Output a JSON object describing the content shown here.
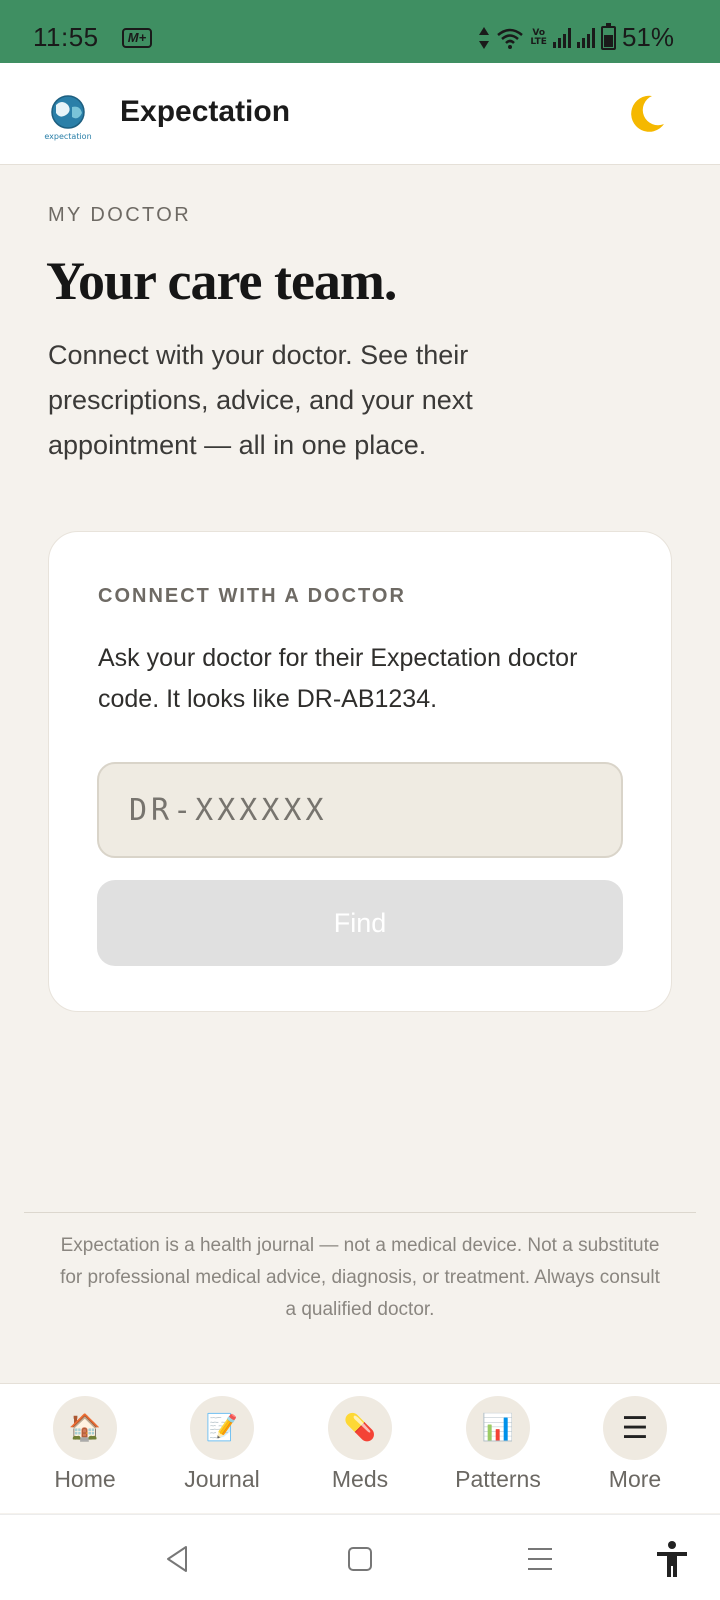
{
  "status_bar": {
    "time": "11:55",
    "app_badge": "M+",
    "network_label": "VoLTE",
    "battery_percent": "51%"
  },
  "header": {
    "app_title": "Expectation",
    "logo_text": "expectation",
    "theme_icon": "moon-icon"
  },
  "main": {
    "eyebrow": "MY DOCTOR",
    "title": "Your care team.",
    "description": "Connect with your doctor. See their prescriptions, advice, and your next appointment — all in one place."
  },
  "connect_card": {
    "label": "CONNECT WITH A DOCTOR",
    "text": "Ask your doctor for their Expectation doctor code. It looks like DR-AB1234.",
    "input_placeholder": "DR-XXXXXX",
    "input_value": "",
    "button_label": "Find"
  },
  "disclaimer": "Expectation is a health journal — not a medical device. Not a substitute for professional medical advice, diagnosis, or treatment. Always consult a qualified doctor.",
  "bottom_nav": {
    "items": [
      {
        "label": "Home",
        "icon": "🏠"
      },
      {
        "label": "Journal",
        "icon": "📝"
      },
      {
        "label": "Meds",
        "icon": "💊"
      },
      {
        "label": "Patterns",
        "icon": "📊"
      },
      {
        "label": "More",
        "icon": "☰"
      }
    ]
  },
  "colors": {
    "status_bar": "#3f8f62",
    "background": "#f5f2ed",
    "input_background": "#efebe2",
    "disabled_button": "#e0e0e0"
  }
}
